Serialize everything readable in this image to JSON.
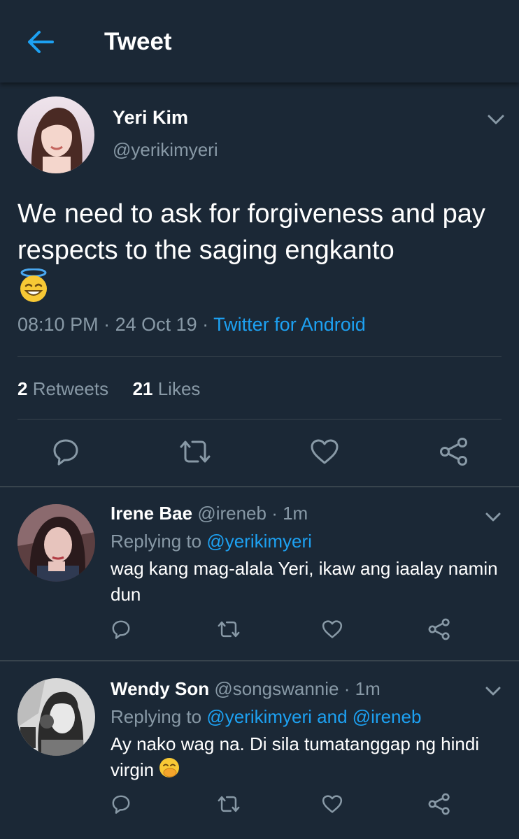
{
  "header": {
    "title": "Tweet"
  },
  "tweet": {
    "author_name": "Yeri Kim",
    "author_handle": "@yerikimyeri",
    "text": "We need to ask for forgiveness and pay respects to the saging engkanto",
    "emoji": "smiling-face-with-halo",
    "time": "08:10 PM",
    "sep1": " · ",
    "date": "24 Oct 19",
    "sep2": " · ",
    "source": "Twitter for Android",
    "retweets_count": "2",
    "retweets_label": "Retweets",
    "likes_count": "21",
    "likes_label": "Likes"
  },
  "replies": [
    {
      "name": "Irene Bae",
      "handle": "@ireneb",
      "dot": " · ",
      "time": "1m",
      "replying_prefix": "Replying to ",
      "mention_1": "@yerikimyeri",
      "text": "wag kang mag-alala Yeri, ikaw ang iaalay namin dun"
    },
    {
      "name": "Wendy Son",
      "handle": "@songswannie",
      "dot": " · ",
      "time": "1m",
      "replying_prefix": "Replying to ",
      "mention_1": "@yerikimyeri",
      "and": " and ",
      "mention_2": "@ireneb",
      "text": "Ay nako wag na. Di sila tumatanggap ng hindi virgin",
      "emoji": "face-with-hand-over-mouth"
    }
  ],
  "colors": {
    "background": "#1b2836",
    "accent": "#1da1f2",
    "secondary_text": "#8899a6",
    "divider": "#38444d"
  }
}
